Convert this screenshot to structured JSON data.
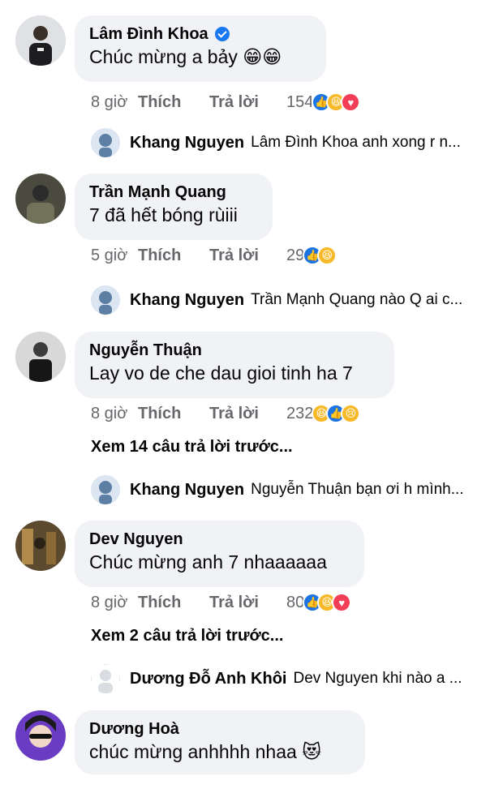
{
  "comments": [
    {
      "author": "Lâm Đình Khoa",
      "verified": true,
      "text": "Chúc mừng a bảy 😁😁",
      "time": "8 giờ",
      "like": "Thích",
      "reply": "Trả lời",
      "count": "154",
      "reactions": [
        "like",
        "haha",
        "love"
      ],
      "view_more": "",
      "latest_reply": {
        "author": "Khang Nguyen",
        "text": "Lâm Đình Khoa anh xong r n..."
      }
    },
    {
      "author": "Trần Mạnh Quang",
      "text": "7 đã hết bóng rùiii",
      "time": "5 giờ",
      "like": "Thích",
      "reply": "Trả lời",
      "count": "29",
      "reactions": [
        "like",
        "haha"
      ],
      "latest_reply": {
        "author": "Khang Nguyen",
        "text": "Trần Mạnh Quang nào Q ai c..."
      }
    },
    {
      "author": "Nguyễn Thuận",
      "text": "Lay vo de che dau gioi tinh ha 7",
      "time": "8 giờ",
      "like": "Thích",
      "reply": "Trả lời",
      "count": "232",
      "reactions": [
        "haha",
        "like",
        "sad"
      ],
      "view_more": "Xem 14 câu trả lời trước...",
      "latest_reply": {
        "author": "Khang Nguyen",
        "text": "Nguyễn Thuận bạn ơi h mình..."
      }
    },
    {
      "author": "Dev Nguyen",
      "text": "Chúc mừng anh 7 nhaaaaaa",
      "time": "8 giờ",
      "like": "Thích",
      "reply": "Trả lời",
      "count": "80",
      "reactions": [
        "like",
        "haha",
        "love"
      ],
      "view_more": "Xem 2 câu trả lời trước...",
      "latest_reply": {
        "author": "Dương Đỗ Anh Khôi",
        "text": "Dev Nguyen khi nào a ..."
      }
    },
    {
      "author": "Dương Hoà",
      "text": "chúc mừng anhhhh nhaa 😻"
    }
  ],
  "colors": {
    "bubble": "#f0f2f5",
    "meta": "#65676b",
    "like_blue": "#1b74e4",
    "haha_yellow": "#f7b928",
    "love_red": "#f33e58"
  }
}
